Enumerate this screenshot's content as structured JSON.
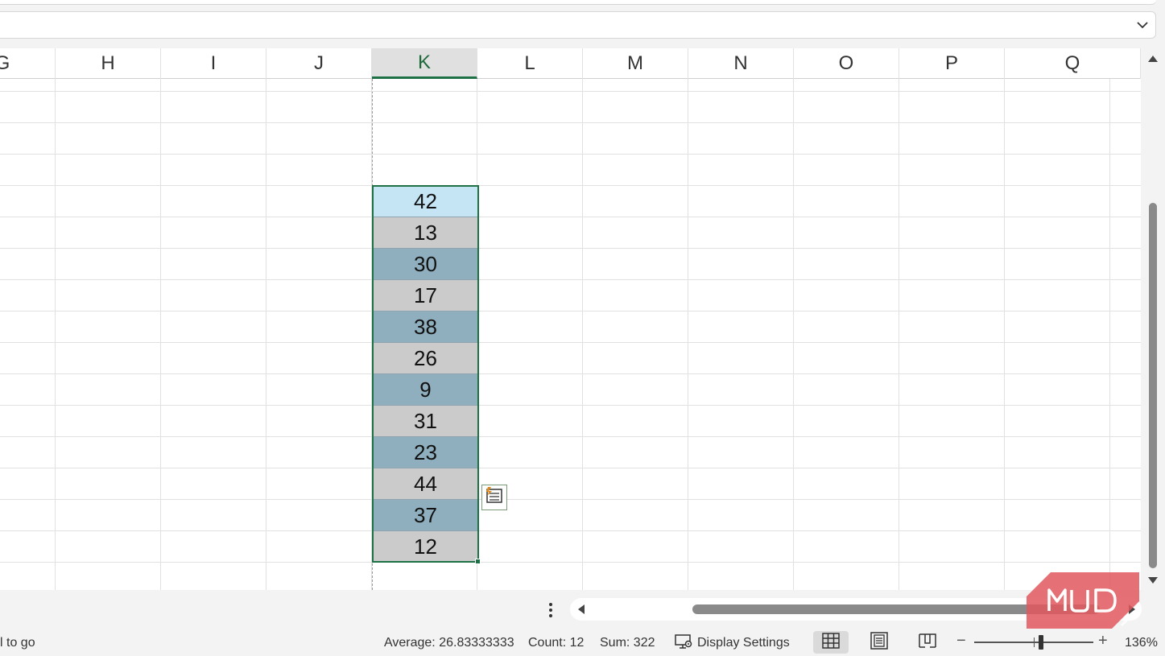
{
  "columns": [
    "G",
    "H",
    "I",
    "J",
    "K",
    "L",
    "M",
    "N",
    "O",
    "P",
    "Q"
  ],
  "selected_column": "K",
  "cells": [
    "42",
    "13",
    "30",
    "17",
    "38",
    "26",
    "9",
    "31",
    "23",
    "44",
    "37",
    "12"
  ],
  "status": {
    "mode": "l to go",
    "average": "Average: 26.83333333",
    "count": "Count: 12",
    "sum": "Sum: 322",
    "display_settings": "Display Settings",
    "zoom": "136%"
  },
  "icons": {
    "formula_expand": "chevron-down-icon",
    "quick_analysis": "quick-analysis-icon",
    "display_settings": "monitor-gear-icon",
    "normal_view": "grid-icon",
    "page_layout_view": "page-icon",
    "page_break_view": "page-break-icon"
  },
  "colors": {
    "selection_border": "#1e7145",
    "active_cell": "#c5e5f5",
    "band_gray": "#cbcbcb",
    "band_blue": "#8fafbe",
    "watermark": "#e0585e"
  }
}
